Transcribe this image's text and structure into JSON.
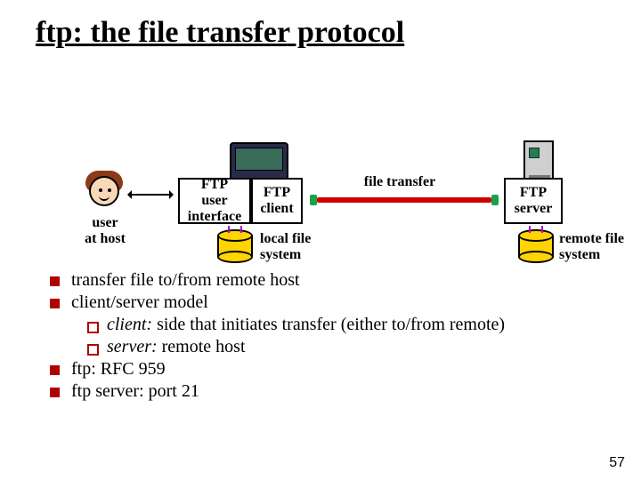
{
  "title": "ftp: the file transfer protocol",
  "diagram": {
    "user_at_host": "user\nat host",
    "ftp_ui": "FTP\nuser\ninterface",
    "ftp_client": "FTP\nclient",
    "ftp_server": "FTP\nserver",
    "file_transfer": "file transfer",
    "local_fs": "local file\nsystem",
    "remote_fs": "remote file\nsystem"
  },
  "bullets": {
    "b1": "transfer file to/from remote host",
    "b2": "client/server model",
    "b2a_em": "client:",
    "b2a_rest": " side that initiates transfer (either to/from remote)",
    "b2b_em": "server:",
    "b2b_rest": " remote host",
    "b3": "ftp: RFC 959",
    "b4": "ftp server: port 21"
  },
  "page_number": "57"
}
